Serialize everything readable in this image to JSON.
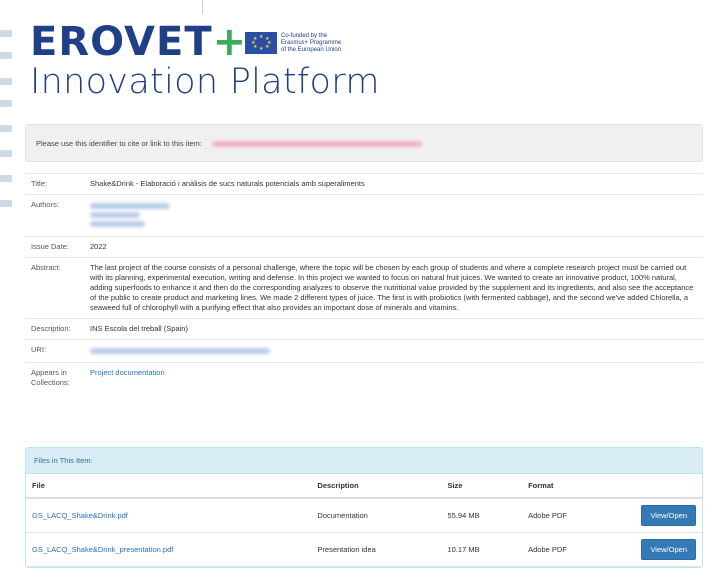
{
  "header": {
    "logo_main": "EROVET",
    "logo_plus": "+",
    "logo_sub": "Innovation Platform",
    "eu_text": [
      "Co-funded by the",
      "Erasmus+ Programme",
      "of the European Union"
    ]
  },
  "cite": {
    "text": "Please use this identifier to cite or link to this item:"
  },
  "metadata": {
    "title_label": "Title:",
    "title_value": "Shake&Drink - Elaboració i anàlisis de sucs naturals potencials amb superaliments",
    "authors_label": "Authors:",
    "issue_date_label": "Issue Date:",
    "issue_date_value": "2022",
    "abstract_label": "Abstract:",
    "abstract_value": "The last project of the course consists of a personal challenge, where the topic will be chosen by each group of students and where a complete research project must be carried out with its planning, experimental execution, writing and defense. In this project we wanted to focus on natural fruit juices. We wanted to create an innovative product, 100% natural, adding superfoods to enhance it and then do the corresponding analyzes to observe the nutritional value provided by the supplement and its ingredients, and also see the acceptance of the public to create product and marketing lines. We made 2 different types of juice. The first is with probiotics (with fermented cabbage), and the second we've added Chlorella, a seaweed full of chlorophyll with a purifying effect that also provides an important dose of minerals and vitamins.",
    "description_label": "Description:",
    "description_value": "INS Escola del treball (Spain)",
    "uri_label": "URI:",
    "collections_label_1": "Appears in",
    "collections_label_2": "Collections:",
    "collections_value": "Project documentation"
  },
  "files": {
    "panel_title": "Files in This Item:",
    "headers": [
      "File",
      "Description",
      "Size",
      "Format",
      ""
    ],
    "rows": [
      {
        "file": "GS_LACQ_Shake&Drink.pdf",
        "description": "Documentation",
        "size": "55.94 MB",
        "format": "Adobe PDF",
        "action": "View/Open"
      },
      {
        "file": "GS_LACQ_Shake&Drink_presentation.pdf",
        "description": "Presentation idea",
        "size": "10.17 MB",
        "format": "Adobe PDF",
        "action": "View/Open"
      }
    ]
  },
  "colors": {
    "brand_blue": "#1f3f86",
    "brand_green": "#3cae5a",
    "link": "#2a6ebb",
    "button": "#337ab7"
  }
}
